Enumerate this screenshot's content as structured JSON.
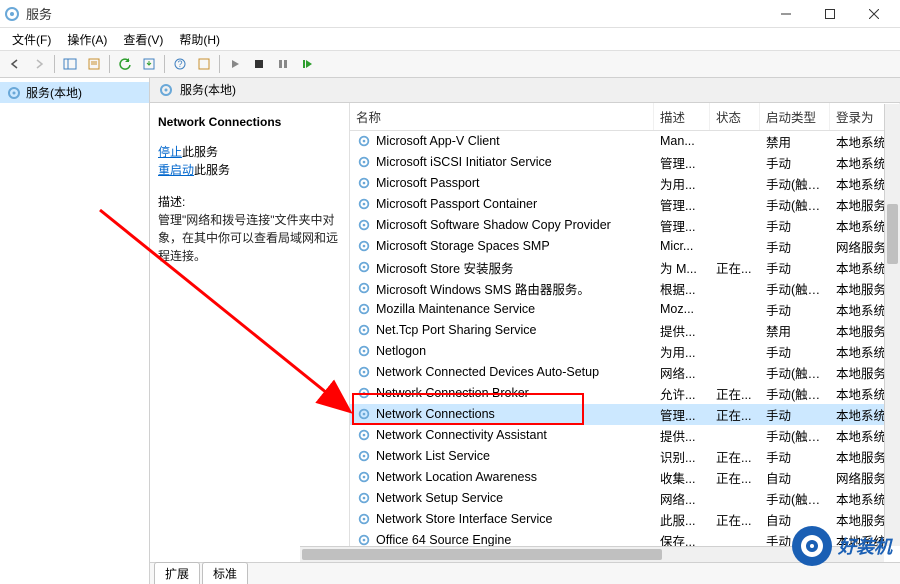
{
  "titlebar": {
    "title": "服务"
  },
  "menubar": {
    "file": "文件(F)",
    "action": "操作(A)",
    "view": "查看(V)",
    "help": "帮助(H)"
  },
  "tree": {
    "root": "服务(本地)"
  },
  "detail_header": {
    "title": "服务(本地)"
  },
  "detail": {
    "selected_name": "Network Connections",
    "stop_link": "停止",
    "stop_suffix": "此服务",
    "restart_link": "重启动",
    "restart_suffix": "此服务",
    "desc_label": "描述:",
    "desc_text": "管理\"网络和拨号连接\"文件夹中对象，在其中你可以查看局域网和远程连接。"
  },
  "columns": {
    "name": "名称",
    "desc": "描述",
    "status": "状态",
    "startup": "启动类型",
    "logon": "登录为"
  },
  "services": [
    {
      "name": "Microsoft App-V Client",
      "desc": "Man...",
      "status": "",
      "startup": "禁用",
      "logon": "本地系统"
    },
    {
      "name": "Microsoft iSCSI Initiator Service",
      "desc": "管理...",
      "status": "",
      "startup": "手动",
      "logon": "本地系统"
    },
    {
      "name": "Microsoft Passport",
      "desc": "为用...",
      "status": "",
      "startup": "手动(触发...",
      "logon": "本地系统"
    },
    {
      "name": "Microsoft Passport Container",
      "desc": "管理...",
      "status": "",
      "startup": "手动(触发...",
      "logon": "本地服务"
    },
    {
      "name": "Microsoft Software Shadow Copy Provider",
      "desc": "管理...",
      "status": "",
      "startup": "手动",
      "logon": "本地系统"
    },
    {
      "name": "Microsoft Storage Spaces SMP",
      "desc": "Micr...",
      "status": "",
      "startup": "手动",
      "logon": "网络服务"
    },
    {
      "name": "Microsoft Store 安装服务",
      "desc": "为 M...",
      "status": "正在...",
      "startup": "手动",
      "logon": "本地系统"
    },
    {
      "name": "Microsoft Windows SMS 路由器服务。",
      "desc": "根据...",
      "status": "",
      "startup": "手动(触发...",
      "logon": "本地服务"
    },
    {
      "name": "Mozilla Maintenance Service",
      "desc": "Moz...",
      "status": "",
      "startup": "手动",
      "logon": "本地系统"
    },
    {
      "name": "Net.Tcp Port Sharing Service",
      "desc": "提供...",
      "status": "",
      "startup": "禁用",
      "logon": "本地服务"
    },
    {
      "name": "Netlogon",
      "desc": "为用...",
      "status": "",
      "startup": "手动",
      "logon": "本地系统"
    },
    {
      "name": "Network Connected Devices Auto-Setup",
      "desc": "网络...",
      "status": "",
      "startup": "手动(触发...",
      "logon": "本地服务"
    },
    {
      "name": "Network Connection Broker",
      "desc": "允许...",
      "status": "正在...",
      "startup": "手动(触发...",
      "logon": "本地系统"
    },
    {
      "name": "Network Connections",
      "desc": "管理...",
      "status": "正在...",
      "startup": "手动",
      "logon": "本地系统",
      "selected": true
    },
    {
      "name": "Network Connectivity Assistant",
      "desc": "提供...",
      "status": "",
      "startup": "手动(触发...",
      "logon": "本地系统"
    },
    {
      "name": "Network List Service",
      "desc": "识别...",
      "status": "正在...",
      "startup": "手动",
      "logon": "本地服务"
    },
    {
      "name": "Network Location Awareness",
      "desc": "收集...",
      "status": "正在...",
      "startup": "自动",
      "logon": "网络服务"
    },
    {
      "name": "Network Setup Service",
      "desc": "网络...",
      "status": "",
      "startup": "手动(触发...",
      "logon": "本地系统"
    },
    {
      "name": "Network Store Interface Service",
      "desc": "此服...",
      "status": "正在...",
      "startup": "自动",
      "logon": "本地服务"
    },
    {
      "name": "Office 64 Source Engine",
      "desc": "保存...",
      "status": "",
      "startup": "手动",
      "logon": "本地系统"
    }
  ],
  "tabs": {
    "extended": "扩展",
    "standard": "标准"
  },
  "watermark": {
    "text": "好装机"
  }
}
